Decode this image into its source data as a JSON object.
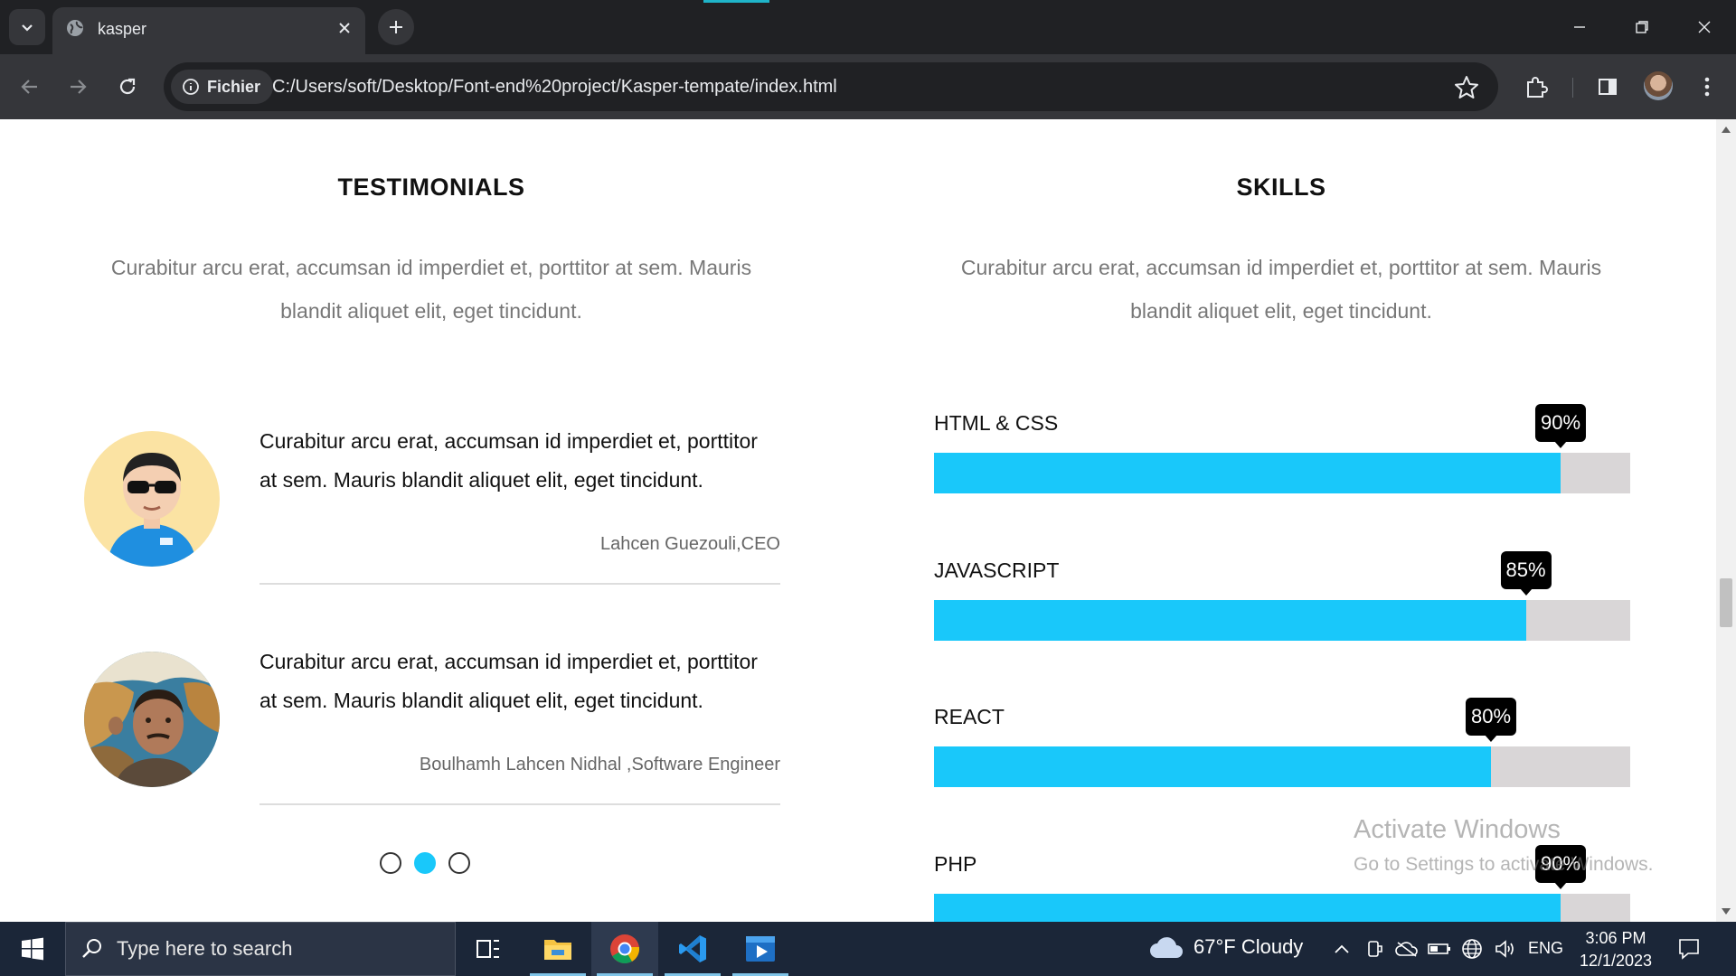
{
  "browser": {
    "tab_title": "kasper",
    "site_chip": "Fichier",
    "url": "C:/Users/soft/Desktop/Font-end%20project/Kasper-tempate/index.html"
  },
  "testimonials": {
    "title": "TESTIMONIALS",
    "description": "Curabitur arcu erat, accumsan id imperdiet et, porttitor at sem. Mauris blandit aliquet elit, eget tincidunt.",
    "items": [
      {
        "text": "Curabitur arcu erat, accumsan id imperdiet et, porttitor at sem. Mauris blandit aliquet elit, eget tincidunt.",
        "author": "Lahcen Guezouli,CEO"
      },
      {
        "text": "Curabitur arcu erat, accumsan id imperdiet et, porttitor at sem. Mauris blandit aliquet elit, eget tincidunt.",
        "author": "Boulhamh Lahcen Nidhal ,Software Engineer"
      }
    ],
    "carousel": {
      "count": 3,
      "active_index": 1
    }
  },
  "skills": {
    "title": "SKILLS",
    "description": "Curabitur arcu erat, accumsan id imperdiet et, porttitor at sem. Mauris blandit aliquet elit, eget tincidunt.",
    "items": [
      {
        "name": "HTML & CSS",
        "percent": 90,
        "label": "90%"
      },
      {
        "name": "JAVASCRIPT",
        "percent": 85,
        "label": "85%"
      },
      {
        "name": "REACT",
        "percent": 80,
        "label": "80%"
      },
      {
        "name": "PHP",
        "percent": 90,
        "label": "90%"
      }
    ],
    "accent_color": "#19c8fa"
  },
  "watermark": {
    "title": "Activate Windows",
    "subtitle": "Go to Settings to activate Windows."
  },
  "taskbar": {
    "search_placeholder": "Type here to search",
    "weather": "67°F  Cloudy",
    "language": "ENG",
    "time": "3:06 PM",
    "date": "12/1/2023"
  }
}
